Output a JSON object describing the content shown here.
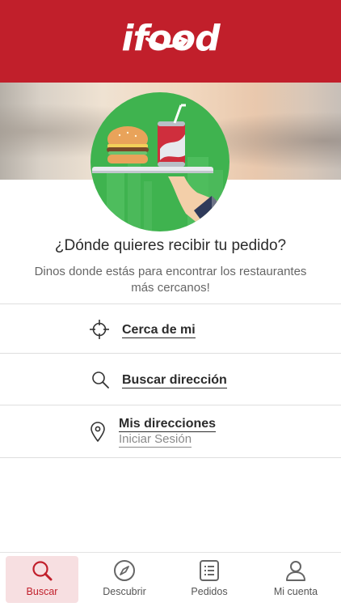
{
  "header": {
    "brand": "ifood",
    "brand_color": "#c11f2b"
  },
  "prompt": {
    "question": "¿Dónde quieres recibir tu pedido?",
    "subtitle": "Dinos donde estás para encontrar los restaurantes más cercanos!"
  },
  "options": [
    {
      "label": "Cerca de mi",
      "icon": "crosshair-icon"
    },
    {
      "label": "Buscar dirección",
      "icon": "search-icon"
    },
    {
      "label": "Mis direcciones",
      "sublabel": "Iniciar Sesión",
      "icon": "location-pin-icon"
    }
  ],
  "tabbar": {
    "items": [
      {
        "label": "Buscar",
        "icon": "search-icon",
        "active": true
      },
      {
        "label": "Descubrir",
        "icon": "compass-icon",
        "active": false
      },
      {
        "label": "Pedidos",
        "icon": "receipt-icon",
        "active": false
      },
      {
        "label": "Mi cuenta",
        "icon": "user-icon",
        "active": false
      }
    ]
  }
}
